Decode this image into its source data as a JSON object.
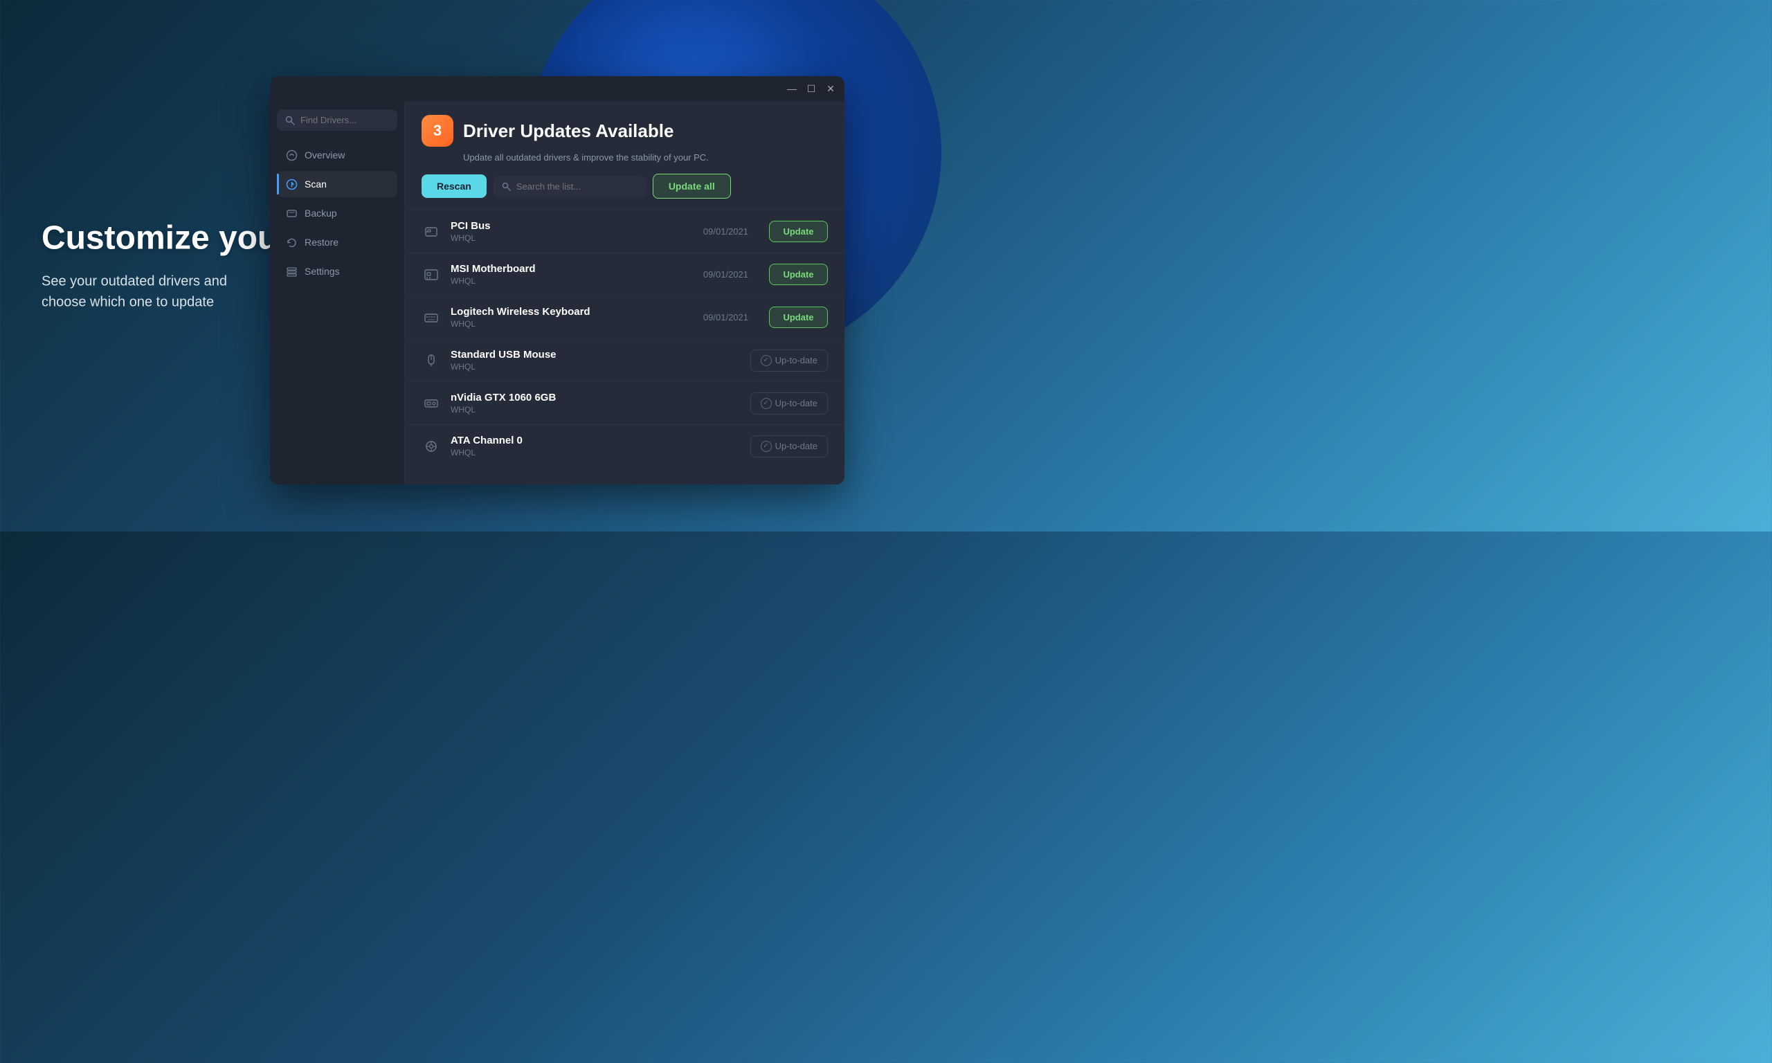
{
  "background": {
    "gradient_start": "#0d2a3a",
    "gradient_end": "#4ab0d8"
  },
  "hero": {
    "title": "Customize your Updates",
    "subtitle": "See your outdated drivers and choose which one to update"
  },
  "window": {
    "title_bar": {
      "minimize_label": "—",
      "maximize_label": "☐",
      "close_label": "✕"
    }
  },
  "sidebar": {
    "search_placeholder": "Find Drivers...",
    "nav_items": [
      {
        "id": "overview",
        "label": "Overview",
        "icon": "cloud"
      },
      {
        "id": "scan",
        "label": "Scan",
        "icon": "scan",
        "active": true
      },
      {
        "id": "backup",
        "label": "Backup",
        "icon": "backup"
      },
      {
        "id": "restore",
        "label": "Restore",
        "icon": "restore"
      },
      {
        "id": "settings",
        "label": "Settings",
        "icon": "settings"
      }
    ]
  },
  "main": {
    "banner": {
      "count": "3",
      "title": "Driver Updates Available",
      "subtitle": "Update all outdated drivers & improve the stability of your PC.",
      "rescan_label": "Rescan",
      "search_placeholder": "Search the list...",
      "update_all_label": "Update all"
    },
    "drivers": [
      {
        "name": "PCI Bus",
        "tag": "WHQL",
        "date": "09/01/2021",
        "status": "update",
        "icon": "chip"
      },
      {
        "name": "MSI Motherboard",
        "tag": "WHQL",
        "date": "09/01/2021",
        "status": "update",
        "icon": "motherboard"
      },
      {
        "name": "Logitech Wireless Keyboard",
        "tag": "WHQL",
        "date": "09/01/2021",
        "status": "update",
        "icon": "keyboard"
      },
      {
        "name": "Standard USB Mouse",
        "tag": "WHQL",
        "date": "",
        "status": "uptodate",
        "icon": "mouse"
      },
      {
        "name": "nVidia GTX 1060 6GB",
        "tag": "WHQL",
        "date": "",
        "status": "uptodate",
        "icon": "gpu"
      },
      {
        "name": "ATA Channel 0",
        "tag": "WHQL",
        "date": "",
        "status": "uptodate",
        "icon": "gear"
      }
    ],
    "update_btn_label": "Update",
    "uptodate_btn_label": "Up-to-date"
  }
}
